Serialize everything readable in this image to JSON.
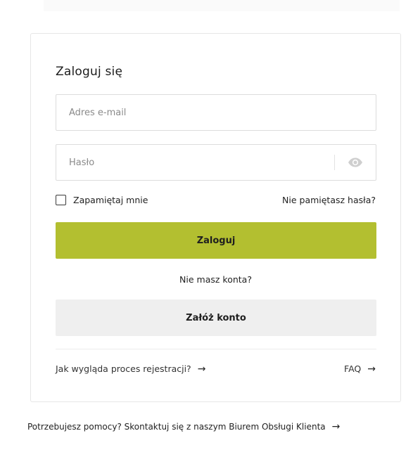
{
  "login": {
    "title": "Zaloguj się",
    "email_placeholder": "Adres e-mail",
    "password_placeholder": "Hasło",
    "remember_label": "Zapamiętaj mnie",
    "forgot_label": "Nie pamiętasz hasła?",
    "submit_label": "Zaloguj",
    "no_account_text": "Nie masz konta?",
    "register_label": "Załóż konto",
    "process_link": "Jak wygląda proces rejestracji?",
    "faq_link": "FAQ",
    "arrow": "→"
  },
  "help": {
    "text": "Potrzebujesz pomocy? Skontaktuj się z naszym Biurem Obsługi Klienta",
    "arrow": "→"
  },
  "colors": {
    "primary_button": "#b3bf30",
    "secondary_button": "#efefef",
    "border": "#dcdcdc"
  },
  "icons": {
    "password_toggle": "eye-icon"
  }
}
